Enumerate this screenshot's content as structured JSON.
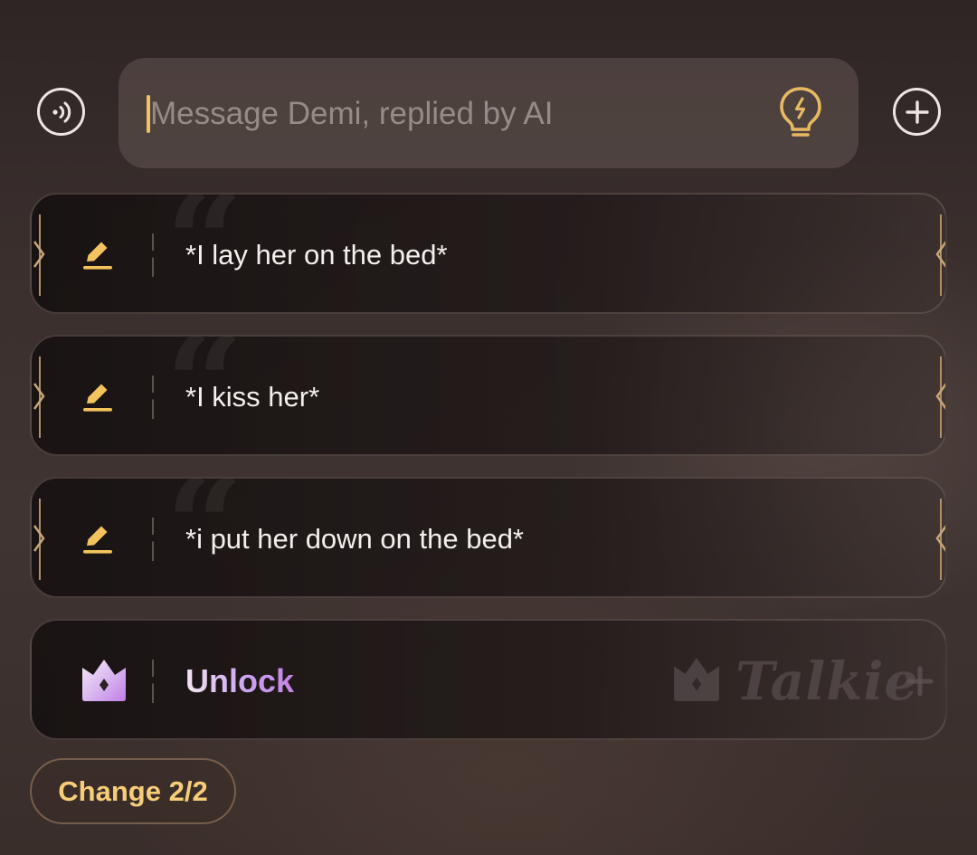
{
  "input": {
    "placeholder": "Message Demi, replied by AI",
    "value": ""
  },
  "icons": {
    "voice": "voice-wave-icon",
    "idea": "lightbulb-icon",
    "add": "plus-circle-icon",
    "edit": "pencil-icon",
    "premium": "crown-icon"
  },
  "suggestions": [
    {
      "text": "*I lay her on the bed*"
    },
    {
      "text": "*I kiss her*"
    },
    {
      "text": "*i put her down on the bed*"
    }
  ],
  "unlock": {
    "label": "Unlock",
    "brand": "Talkie"
  },
  "change_button": {
    "label": "Change 2/2"
  },
  "colors": {
    "accent_gold": "#f0c265",
    "unlock_gradient_start": "#f2e4f0",
    "unlock_gradient_end": "#c582e6",
    "text_primary": "#f4efec",
    "placeholder": "#978b87"
  }
}
